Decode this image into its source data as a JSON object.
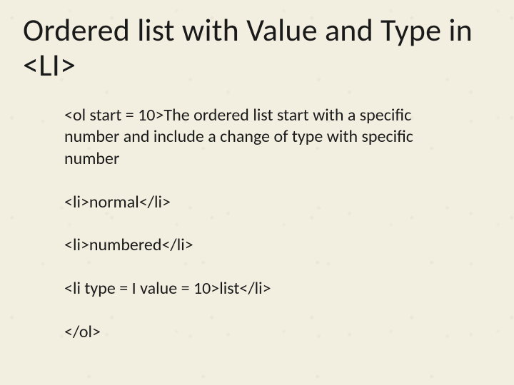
{
  "title": "Ordered list with Value and Type in <LI>",
  "paragraphs": [
    "<ol start = 10>The ordered list start with a specific number and include a change of type with specific number",
    "<li>normal</li>",
    "<li>numbered</li>",
    "<li type = I value = 10>list</li>",
    "</ol>"
  ]
}
